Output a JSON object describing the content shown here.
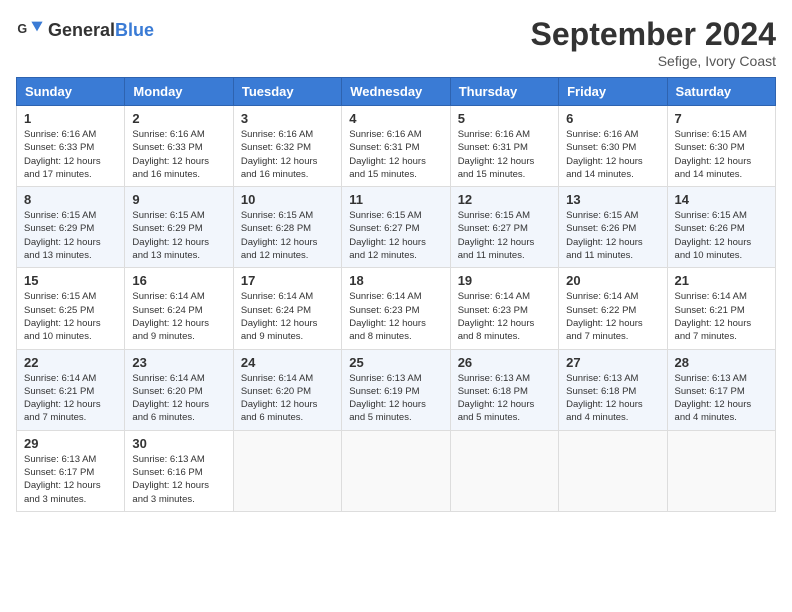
{
  "header": {
    "logo_general": "General",
    "logo_blue": "Blue",
    "month_title": "September 2024",
    "location": "Sefige, Ivory Coast"
  },
  "days_of_week": [
    "Sunday",
    "Monday",
    "Tuesday",
    "Wednesday",
    "Thursday",
    "Friday",
    "Saturday"
  ],
  "weeks": [
    [
      {
        "day": "1",
        "sunrise": "6:16 AM",
        "sunset": "6:33 PM",
        "daylight": "12 hours and 17 minutes."
      },
      {
        "day": "2",
        "sunrise": "6:16 AM",
        "sunset": "6:33 PM",
        "daylight": "12 hours and 16 minutes."
      },
      {
        "day": "3",
        "sunrise": "6:16 AM",
        "sunset": "6:32 PM",
        "daylight": "12 hours and 16 minutes."
      },
      {
        "day": "4",
        "sunrise": "6:16 AM",
        "sunset": "6:31 PM",
        "daylight": "12 hours and 15 minutes."
      },
      {
        "day": "5",
        "sunrise": "6:16 AM",
        "sunset": "6:31 PM",
        "daylight": "12 hours and 15 minutes."
      },
      {
        "day": "6",
        "sunrise": "6:16 AM",
        "sunset": "6:30 PM",
        "daylight": "12 hours and 14 minutes."
      },
      {
        "day": "7",
        "sunrise": "6:15 AM",
        "sunset": "6:30 PM",
        "daylight": "12 hours and 14 minutes."
      }
    ],
    [
      {
        "day": "8",
        "sunrise": "6:15 AM",
        "sunset": "6:29 PM",
        "daylight": "12 hours and 13 minutes."
      },
      {
        "day": "9",
        "sunrise": "6:15 AM",
        "sunset": "6:29 PM",
        "daylight": "12 hours and 13 minutes."
      },
      {
        "day": "10",
        "sunrise": "6:15 AM",
        "sunset": "6:28 PM",
        "daylight": "12 hours and 12 minutes."
      },
      {
        "day": "11",
        "sunrise": "6:15 AM",
        "sunset": "6:27 PM",
        "daylight": "12 hours and 12 minutes."
      },
      {
        "day": "12",
        "sunrise": "6:15 AM",
        "sunset": "6:27 PM",
        "daylight": "12 hours and 11 minutes."
      },
      {
        "day": "13",
        "sunrise": "6:15 AM",
        "sunset": "6:26 PM",
        "daylight": "12 hours and 11 minutes."
      },
      {
        "day": "14",
        "sunrise": "6:15 AM",
        "sunset": "6:26 PM",
        "daylight": "12 hours and 10 minutes."
      }
    ],
    [
      {
        "day": "15",
        "sunrise": "6:15 AM",
        "sunset": "6:25 PM",
        "daylight": "12 hours and 10 minutes."
      },
      {
        "day": "16",
        "sunrise": "6:14 AM",
        "sunset": "6:24 PM",
        "daylight": "12 hours and 9 minutes."
      },
      {
        "day": "17",
        "sunrise": "6:14 AM",
        "sunset": "6:24 PM",
        "daylight": "12 hours and 9 minutes."
      },
      {
        "day": "18",
        "sunrise": "6:14 AM",
        "sunset": "6:23 PM",
        "daylight": "12 hours and 8 minutes."
      },
      {
        "day": "19",
        "sunrise": "6:14 AM",
        "sunset": "6:23 PM",
        "daylight": "12 hours and 8 minutes."
      },
      {
        "day": "20",
        "sunrise": "6:14 AM",
        "sunset": "6:22 PM",
        "daylight": "12 hours and 7 minutes."
      },
      {
        "day": "21",
        "sunrise": "6:14 AM",
        "sunset": "6:21 PM",
        "daylight": "12 hours and 7 minutes."
      }
    ],
    [
      {
        "day": "22",
        "sunrise": "6:14 AM",
        "sunset": "6:21 PM",
        "daylight": "12 hours and 7 minutes."
      },
      {
        "day": "23",
        "sunrise": "6:14 AM",
        "sunset": "6:20 PM",
        "daylight": "12 hours and 6 minutes."
      },
      {
        "day": "24",
        "sunrise": "6:14 AM",
        "sunset": "6:20 PM",
        "daylight": "12 hours and 6 minutes."
      },
      {
        "day": "25",
        "sunrise": "6:13 AM",
        "sunset": "6:19 PM",
        "daylight": "12 hours and 5 minutes."
      },
      {
        "day": "26",
        "sunrise": "6:13 AM",
        "sunset": "6:18 PM",
        "daylight": "12 hours and 5 minutes."
      },
      {
        "day": "27",
        "sunrise": "6:13 AM",
        "sunset": "6:18 PM",
        "daylight": "12 hours and 4 minutes."
      },
      {
        "day": "28",
        "sunrise": "6:13 AM",
        "sunset": "6:17 PM",
        "daylight": "12 hours and 4 minutes."
      }
    ],
    [
      {
        "day": "29",
        "sunrise": "6:13 AM",
        "sunset": "6:17 PM",
        "daylight": "12 hours and 3 minutes."
      },
      {
        "day": "30",
        "sunrise": "6:13 AM",
        "sunset": "6:16 PM",
        "daylight": "12 hours and 3 minutes."
      },
      null,
      null,
      null,
      null,
      null
    ]
  ]
}
